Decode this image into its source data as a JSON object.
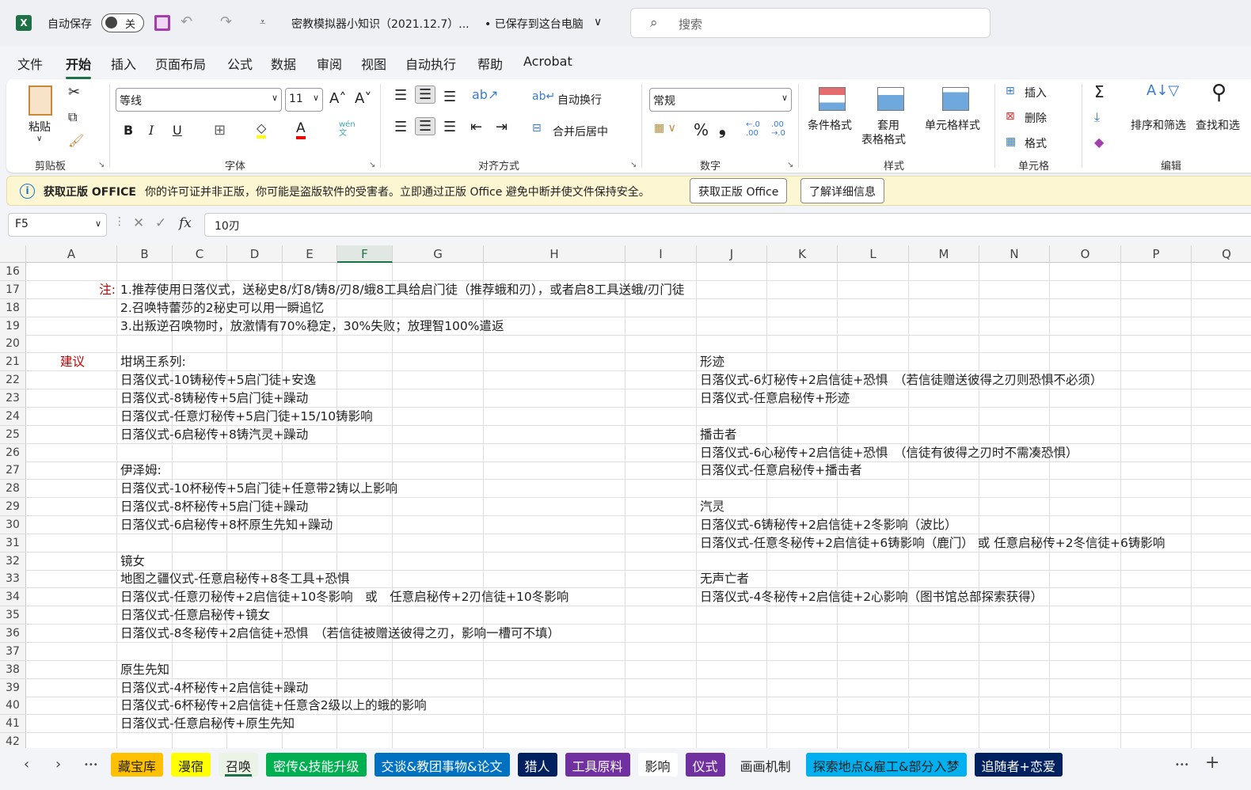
{
  "titlebar": {
    "autosave_label": "自动保存",
    "autosave_state": "关",
    "doc_title": "密教模拟器小知识（2021.12.7）...",
    "save_status": "• 已保存到这台电脑",
    "save_status_chevron": "∨",
    "search_placeholder": "搜索"
  },
  "menu_tabs": [
    "文件",
    "开始",
    "插入",
    "页面布局",
    "公式",
    "数据",
    "审阅",
    "视图",
    "自动执行",
    "帮助",
    "Acrobat"
  ],
  "ribbon": {
    "clipboard": {
      "paste": "粘贴",
      "label": "剪贴板"
    },
    "font": {
      "name": "等线",
      "size": "11",
      "label": "字体",
      "bold": "B",
      "italic": "I",
      "underline": "U",
      "phonetic": "wén 文"
    },
    "alignment": {
      "wrap": "自动换行",
      "merge": "合并后居中",
      "label": "对齐方式"
    },
    "number": {
      "format": "常规",
      "percent": "%",
      "comma": "❟",
      "inc_decimal": "←.0 .00",
      "dec_decimal": ".00 →.0",
      "label": "数字"
    },
    "styles": {
      "conditional": "条件格式",
      "table1": "套用",
      "table2": "表格格式",
      "cell_styles": "单元格样式",
      "label": "样式"
    },
    "cells": {
      "insert": "插入",
      "delete": "删除",
      "format": "格式",
      "label": "单元格"
    },
    "editing": {
      "sort": "排序和筛选",
      "find": "查找和选",
      "label": "编辑",
      "sum": "Σ"
    }
  },
  "infobar": {
    "title": "获取正版 OFFICE",
    "message": "你的许可证并非正版，你可能是盗版软件的受害者。立即通过正版 Office 避免中断并使文件保持安全。",
    "btn_get": "获取正版 Office",
    "btn_learn": "了解详细信息"
  },
  "formula": {
    "namebox": "F5",
    "value": "10刃",
    "fx": "fx"
  },
  "selected_column": "F",
  "columns": [
    "A",
    "B",
    "C",
    "D",
    "E",
    "F",
    "G",
    "H",
    "I",
    "J",
    "K",
    "L",
    "M",
    "N",
    "O",
    "P",
    "Q"
  ],
  "accent_red": "#c00000",
  "rows": [
    {
      "num": "16",
      "cells": {}
    },
    {
      "num": "17",
      "cells": {
        "A": "注:",
        "B": "1.推荐使用日落仪式，送秘史8/灯8/铸8/刃8/蛾8工具给启门徒（推荐蛾和刃），或者启8工具送蛾/刃门徒"
      }
    },
    {
      "num": "18",
      "cells": {
        "B": "2.召唤特蕾莎的2秘史可以用一瞬追忆"
      }
    },
    {
      "num": "19",
      "cells": {
        "B": "3.出叛逆召唤物时，放激情有70%稳定，30%失败；放理智100%遣返"
      }
    },
    {
      "num": "20",
      "cells": {}
    },
    {
      "num": "21",
      "cells": {
        "A": "建议",
        "B": "坩埚王系列:",
        "J": "形迹"
      }
    },
    {
      "num": "22",
      "cells": {
        "B": "日落仪式-10铸秘传+5启门徒+安逸",
        "J": "日落仪式-6灯秘传+2启信徒+恐惧　（若信徒赠送彼得之刃则恐惧不必须）"
      }
    },
    {
      "num": "23",
      "cells": {
        "B": "日落仪式-8铸秘传+5启门徒+躁动",
        "J": "日落仪式-任意启秘传+形迹"
      }
    },
    {
      "num": "24",
      "cells": {
        "B": "日落仪式-任意灯秘传+5启门徒+15/10铸影响"
      }
    },
    {
      "num": "25",
      "cells": {
        "B": "日落仪式-6启秘传+8铸汽灵+躁动",
        "J": "播击者"
      }
    },
    {
      "num": "26",
      "cells": {
        "J": "日落仪式-6心秘传+2启信徒+恐惧　（信徒有彼得之刃时不需凑恐惧）"
      }
    },
    {
      "num": "27",
      "cells": {
        "B": "伊泽姆:",
        "J": "日落仪式-任意启秘传+播击者"
      }
    },
    {
      "num": "28",
      "cells": {
        "B": "日落仪式-10杯秘传+5启门徒+任意带2铸以上影响"
      }
    },
    {
      "num": "29",
      "cells": {
        "B": "日落仪式-8杯秘传+5启门徒+躁动",
        "J": "汽灵"
      }
    },
    {
      "num": "30",
      "cells": {
        "B": "日落仪式-6启秘传+8杯原生先知+躁动",
        "J": "日落仪式-6铸秘传+2启信徒+2冬影响（波比）"
      }
    },
    {
      "num": "31",
      "cells": {
        "J": "日落仪式-任意冬秘传+2启信徒+6铸影响（鹿门） 或  任意启秘传+2冬信徒+6铸影响"
      }
    },
    {
      "num": "32",
      "cells": {
        "B": "镜女"
      }
    },
    {
      "num": "33",
      "cells": {
        "B": "地图之疆仪式-任意启秘传+8冬工具+恐惧",
        "J": "无声亡者"
      }
    },
    {
      "num": "34",
      "cells": {
        "B": "日落仪式-任意刃秘传+2启信徒+10冬影响　或　任意启秘传+2刃信徒+10冬影响",
        "J": "日落仪式-4冬秘传+2启信徒+2心影响（图书馆总部探索获得）"
      }
    },
    {
      "num": "35",
      "cells": {
        "B": "日落仪式-任意启秘传+镜女"
      }
    },
    {
      "num": "36",
      "cells": {
        "B": "日落仪式-8冬秘传+2启信徒+恐惧　（若信徒被赠送彼得之刃，影响一槽可不填）"
      }
    },
    {
      "num": "37",
      "cells": {}
    },
    {
      "num": "38",
      "cells": {
        "B": "原生先知"
      }
    },
    {
      "num": "39",
      "cells": {
        "B": "日落仪式-4杯秘传+2启信徒+躁动"
      }
    },
    {
      "num": "40",
      "cells": {
        "B": "日落仪式-6杯秘传+2启信徒+任意含2级以上的蛾的影响"
      }
    },
    {
      "num": "41",
      "cells": {
        "B": "日落仪式-任意启秘传+原生先知"
      }
    },
    {
      "num": "42",
      "cells": {}
    }
  ],
  "sheet_tabs": [
    {
      "label": "藏宝库",
      "bg": "#ffc000",
      "fg": "#222"
    },
    {
      "label": "漫宿",
      "bg": "#ffff00",
      "fg": "#222"
    },
    {
      "label": "召唤",
      "bg": "#eaf3e6",
      "fg": "#222",
      "active": true
    },
    {
      "label": "密传&技能升级",
      "bg": "#00b050",
      "fg": "#fff"
    },
    {
      "label": "交谈&教团事物&论文",
      "bg": "#0070c0",
      "fg": "#fff"
    },
    {
      "label": "猎人",
      "bg": "#002060",
      "fg": "#fff"
    },
    {
      "label": "工具原料",
      "bg": "#7030a0",
      "fg": "#fff"
    },
    {
      "label": "影响",
      "bg": "#ffffff",
      "fg": "#222"
    },
    {
      "label": "仪式",
      "bg": "#7030a0",
      "fg": "#fff"
    },
    {
      "label": "画画机制",
      "bg": "#f3f4f7",
      "fg": "#222"
    },
    {
      "label": "探索地点&雇工&部分入梦",
      "bg": "#00b0f0",
      "fg": "#222"
    },
    {
      "label": "追随者+恋爱",
      "bg": "#002060",
      "fg": "#fff"
    }
  ],
  "sheet_nav": {
    "prev": "‹",
    "next": "›",
    "more": "•••",
    "add": "+"
  }
}
